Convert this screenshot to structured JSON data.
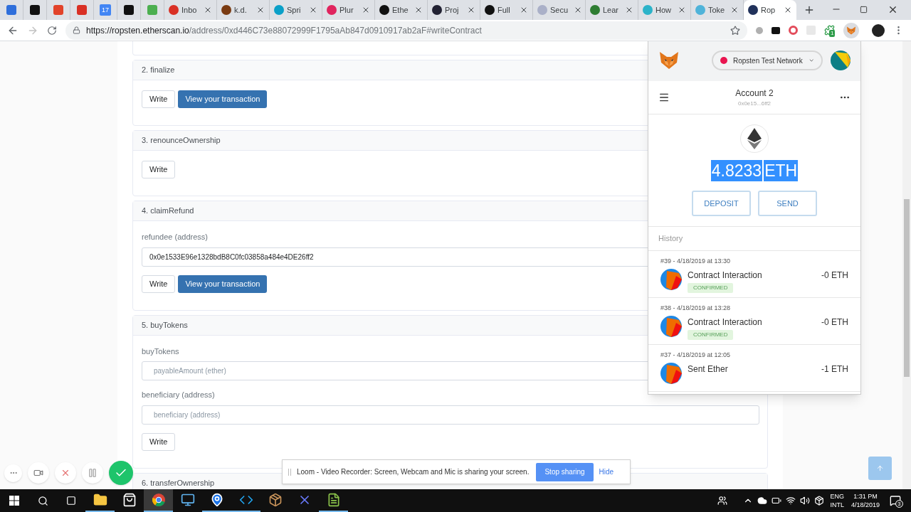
{
  "browser": {
    "pinned_tabs": [
      {
        "color": "#2f6fdb"
      },
      {
        "color": "#111111"
      },
      {
        "color": "#e2432a"
      },
      {
        "color": "#d93025"
      },
      {
        "color": "#4285f4",
        "text": "17"
      },
      {
        "color": "#111111"
      },
      {
        "color": "#4caf50"
      }
    ],
    "tabs": [
      {
        "title": "Inbo",
        "color": "#d93025",
        "selected": false
      },
      {
        "title": "k.d.",
        "color": "#7a3b12",
        "selected": false
      },
      {
        "title": "Spri",
        "color": "#0aa0c8",
        "selected": false
      },
      {
        "title": "Plur",
        "color": "#e0245e",
        "selected": false
      },
      {
        "title": "Ethe",
        "color": "#111111",
        "selected": false
      },
      {
        "title": "Proj",
        "color": "#222233",
        "selected": false
      },
      {
        "title": "Full",
        "color": "#111111",
        "selected": false
      },
      {
        "title": "Secu",
        "color": "#aab0c8",
        "selected": false
      },
      {
        "title": "Lear",
        "color": "#2e7d32",
        "selected": false
      },
      {
        "title": "How",
        "color": "#2bb3c9",
        "selected": false
      },
      {
        "title": "Toke",
        "color": "#4fb3d9",
        "selected": false
      },
      {
        "title": "Rop",
        "color": "#21325b",
        "selected": true
      }
    ],
    "url_host": "https://ropsten.etherscan.io",
    "url_path": "/address/0xd446C73e88072999F1795aAb847d0910917ab2aF#writeContract",
    "extension_badge": "1"
  },
  "contract": {
    "functions": [
      {
        "title": "2. finalize",
        "write": "Write",
        "view": "View your transaction"
      },
      {
        "title": "3. renounceOwnership",
        "write": "Write"
      },
      {
        "title": "4. claimRefund",
        "fields": [
          {
            "label": "refundee (address)",
            "value": "0x0e1533E96e1328bdB8C0fc03858a484e4DE26ff2"
          }
        ],
        "write": "Write",
        "view": "View your transaction"
      },
      {
        "title": "5. buyTokens",
        "fields": [
          {
            "label": "buyTokens",
            "placeholder": "payableAmount (ether)"
          },
          {
            "label": "beneficiary (address)",
            "placeholder": "beneficiary (address)"
          }
        ],
        "write": "Write"
      },
      {
        "title": "6. transferOwnership"
      }
    ]
  },
  "metamask": {
    "network": "Ropsten Test Network",
    "account": "Account 2",
    "address": "0x0e15...6ff2",
    "balance": "4.8233",
    "unit": "ETH",
    "highlighted": true,
    "buttons": [
      "DEPOSIT",
      "SEND"
    ],
    "history_label": "History",
    "transactions": [
      {
        "meta": "#39 - 4/18/2019 at 13:30",
        "title": "Contract Interaction",
        "amount": "-0 ETH",
        "status": "CONFIRMED"
      },
      {
        "meta": "#38 - 4/18/2019 at 13:28",
        "title": "Contract Interaction",
        "amount": "-0 ETH",
        "status": "CONFIRMED"
      },
      {
        "meta": "#37 - 4/18/2019 at 12:05",
        "title": "Sent Ether",
        "amount": "-1 ETH"
      }
    ]
  },
  "loom": {
    "message": "Loom - Video Recorder: Screen, Webcam and Mic is sharing your screen.",
    "stop": "Stop sharing",
    "hide": "Hide"
  },
  "taskbar": {
    "apps": [
      {
        "kind": "explorer",
        "running": true,
        "selected": false
      },
      {
        "kind": "store",
        "running": false,
        "selected": false
      },
      {
        "kind": "chrome",
        "running": true,
        "selected": true
      },
      {
        "kind": "monitor",
        "running": false,
        "selected": false
      },
      {
        "kind": "maps",
        "running": true,
        "selected": false
      },
      {
        "kind": "vscode",
        "running": true,
        "selected": false
      },
      {
        "kind": "box",
        "running": false,
        "selected": false
      },
      {
        "kind": "cross",
        "running": false,
        "selected": false
      },
      {
        "kind": "notepad",
        "running": true,
        "selected": false
      }
    ],
    "language": "ENG",
    "layout": "INTL",
    "time": "1:31 PM",
    "date": "4/18/2019",
    "notifications": "3"
  }
}
